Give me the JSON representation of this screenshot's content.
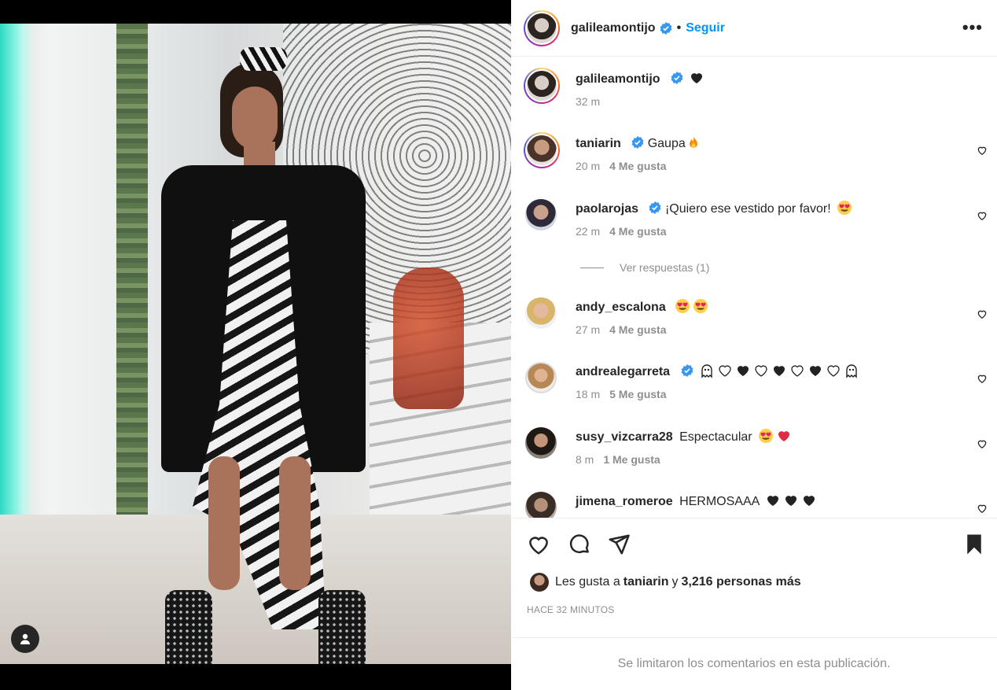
{
  "post": {
    "author": "galileamontijo",
    "follow_label": "Seguir",
    "separator": "•",
    "more_label": "•••",
    "caption_time": "32 m",
    "likes_prefix": "Les gusta a",
    "likes_user": "taniarin",
    "likes_middle": "y",
    "likes_count": "3,216 personas más",
    "time_ago": "HACE 32 MINUTOS",
    "comments_limited": "Se limitaron los comentarios en esta publicación."
  },
  "comments": [
    {
      "user": "taniarin",
      "text": "Gaupa",
      "time": "20 m",
      "likes": "4 Me gusta"
    },
    {
      "user": "paolarojas",
      "text": "¡Quiero ese vestido por favor!",
      "time": "22 m",
      "likes": "4 Me gusta"
    },
    {
      "user": "andy_escalona",
      "text": "",
      "time": "27 m",
      "likes": "4 Me gusta"
    },
    {
      "user": "andrealegarreta",
      "text": "",
      "time": "18 m",
      "likes": "5 Me gusta"
    },
    {
      "user": "susy_vizcarra28",
      "text": "Espectacular",
      "time": "8 m",
      "likes": "1 Me gusta"
    },
    {
      "user": "jimena_romeroe",
      "text": "HERMOSAAA",
      "time": "",
      "likes": ""
    }
  ],
  "replies_label": "Ver respuestas (1)",
  "icons": [
    "verified-badge-icon",
    "heart-icon",
    "comment-icon",
    "share-icon",
    "bookmark-icon",
    "user-icon",
    "fire-emoji",
    "heart-eyes-emoji",
    "black-heart-emoji",
    "white-heart-emoji",
    "red-heart-emoji",
    "ghost-emoji"
  ],
  "colors": {
    "link": "#0095f6",
    "verified": "#3897f0",
    "muted": "#8e8e8e",
    "text": "#262626"
  }
}
